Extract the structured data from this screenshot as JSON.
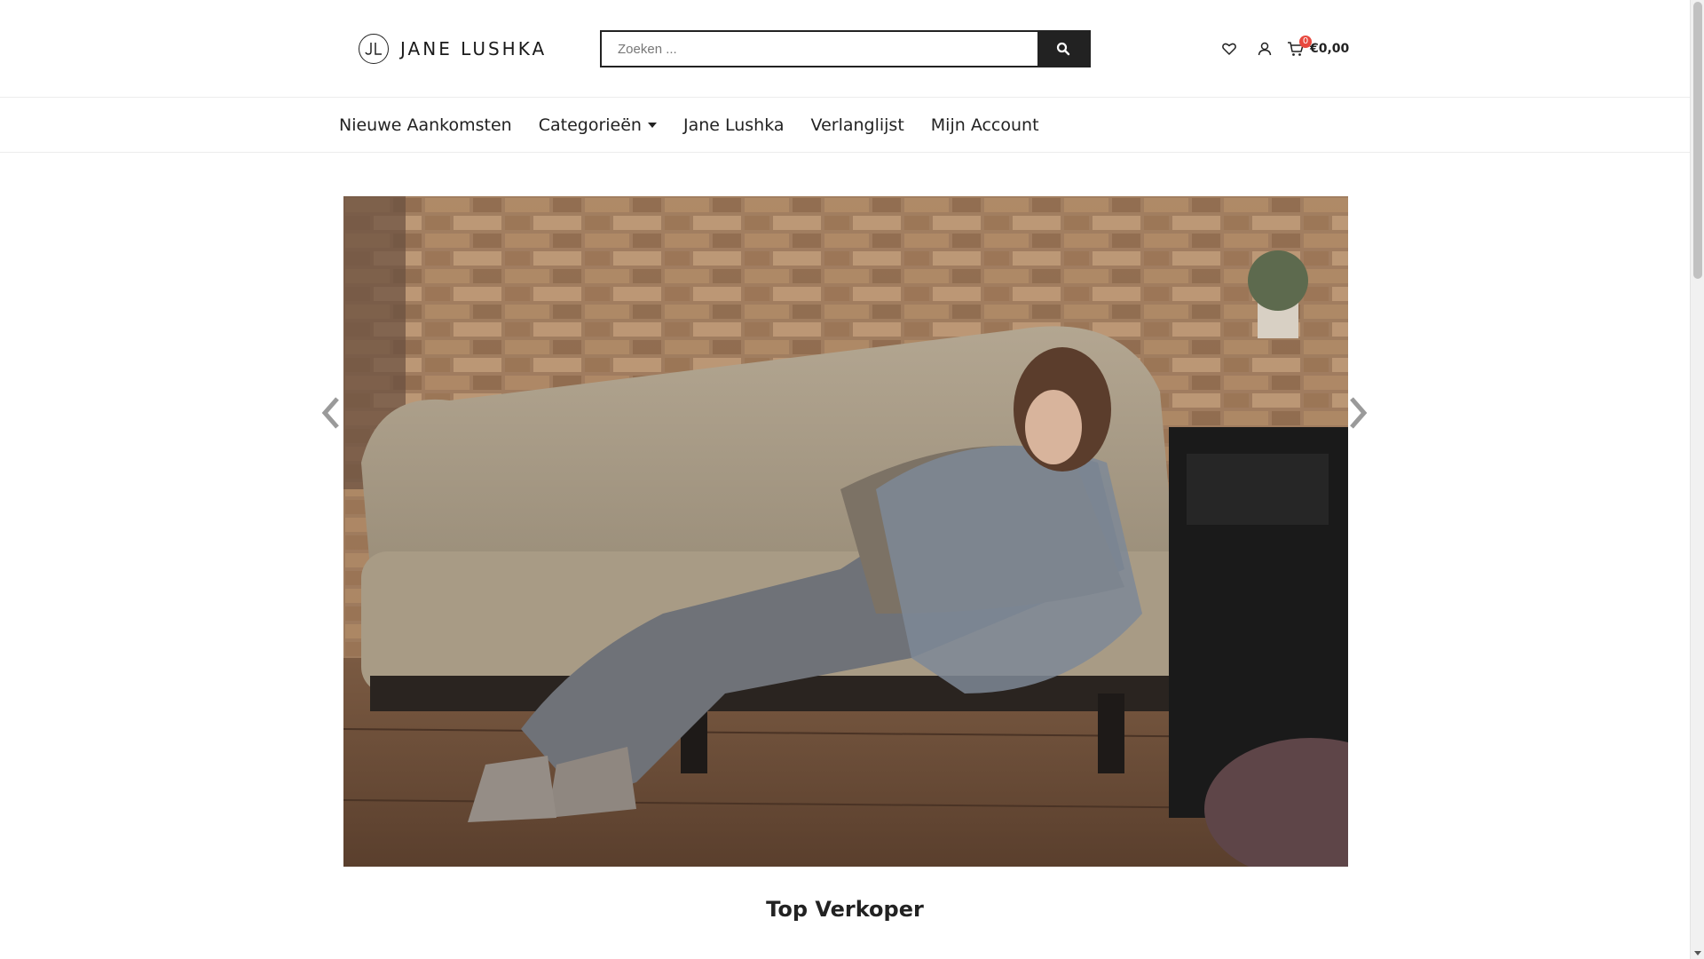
{
  "brand": {
    "name": "JANE LUSHKA",
    "monogram": "JL"
  },
  "search": {
    "placeholder": "Zoeken ...",
    "value": ""
  },
  "header": {
    "icons": [
      "heart-icon",
      "user-icon",
      "cart-icon",
      "search-icon"
    ],
    "cart": {
      "count": "0",
      "total": "€0,00"
    }
  },
  "nav": {
    "items": [
      {
        "label": "Nieuwe Aankomsten"
      },
      {
        "label": "Categorieën",
        "dropdown": true
      },
      {
        "label": "Jane Lushka"
      },
      {
        "label": "Verlanglijst"
      },
      {
        "label": "Mijn Account"
      }
    ]
  },
  "slider": {
    "icons": [
      "chevron-left-icon",
      "chevron-right-icon"
    ]
  },
  "sections": {
    "top_seller_title": "Top Verkoper"
  },
  "colors": {
    "accent": "#222222",
    "badge": "#e8493f",
    "border": "#ececec"
  }
}
